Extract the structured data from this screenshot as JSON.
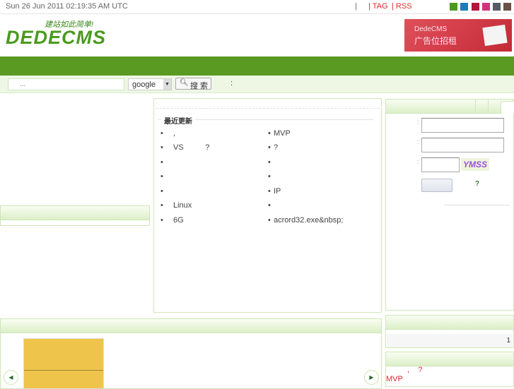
{
  "topbar": {
    "datetime": "Sun 26 Jun 2011 02:19:35 AM UTC",
    "sep": "|",
    "tag": "| TAG",
    "rss": "| RSS",
    "theme_colors": [
      "#4a9a1e",
      "#1f7ab8",
      "#b5143c",
      "#d6307a",
      "#555b66",
      "#6b5048"
    ]
  },
  "logo": {
    "slogan": "建站如此简单!",
    "text": "DEDECMS"
  },
  "banner": {
    "line1": "DedeCMS",
    "line2": "广告位招租"
  },
  "search": {
    "placeholder": "...",
    "engine": "google",
    "button": "搜 索",
    "colon": ":"
  },
  "center": {
    "heading": "最近更新",
    "left_items": [
      ",",
      "VS          ?",
      "",
      "",
      "",
      "Linux",
      "6G"
    ],
    "right_items": [
      "MVP",
      "?",
      "",
      "",
      "IP",
      "",
      "acrord32.exe&nbsp;"
    ]
  },
  "login": {
    "colon": ":",
    "captcha": "YMSS",
    "help": "?"
  },
  "stats": {
    "count": "1"
  },
  "news": {
    "line1": ",    ?",
    "line2": "MVP"
  },
  "colors": {
    "nav": "#5a9a22",
    "search_bg": "#eef7e4",
    "border": "#cfe6b8"
  }
}
